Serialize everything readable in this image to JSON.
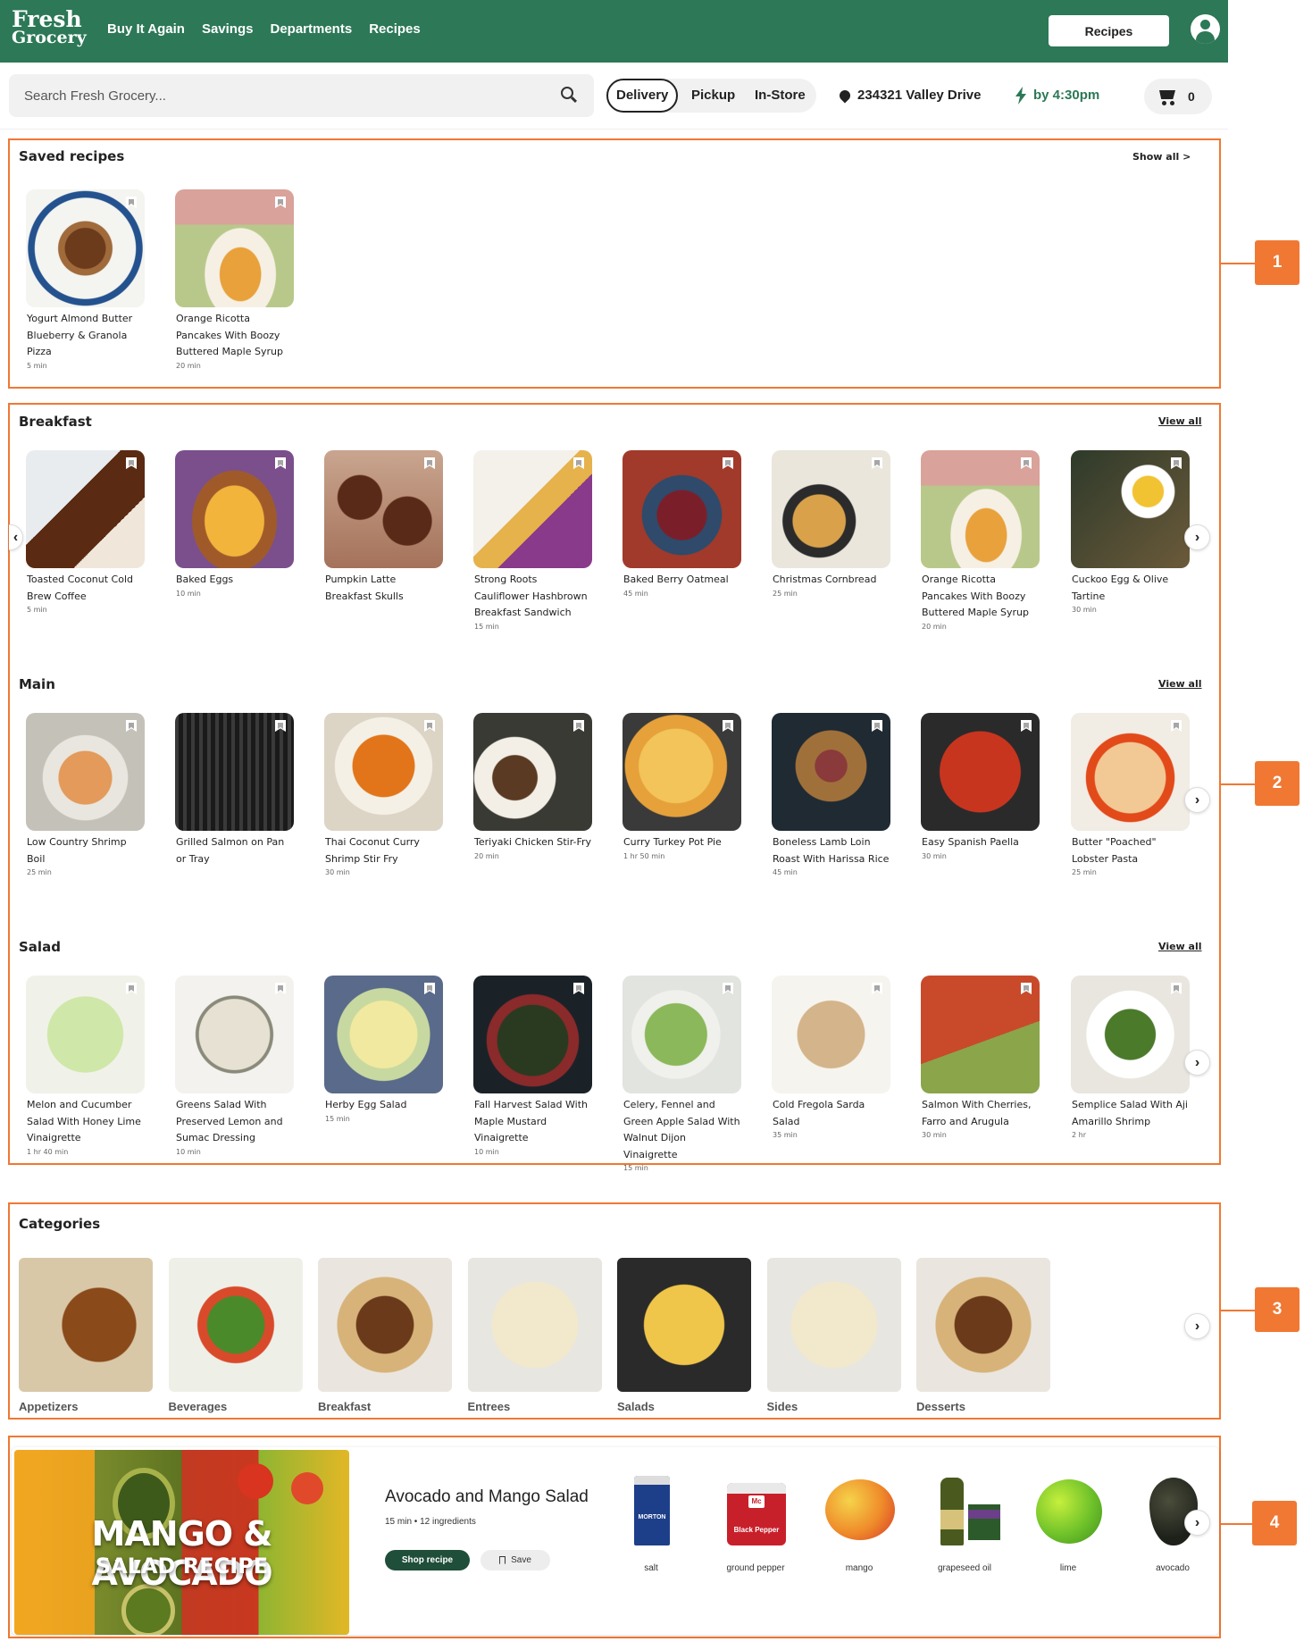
{
  "header": {
    "logo_line1": "Fresh",
    "logo_line2": "Grocery",
    "nav": [
      "Buy It Again",
      "Savings",
      "Departments",
      "Recipes"
    ],
    "recipes_button": "Recipes"
  },
  "search": {
    "placeholder": "Search Fresh Grocery...",
    "modes": [
      "Delivery",
      "Pickup",
      "In-Store"
    ],
    "active_mode": "Delivery",
    "address": "234321 Valley Drive",
    "eta": "by 4:30pm",
    "cart_count": "0"
  },
  "saved": {
    "title": "Saved recipes",
    "show_all": "Show all >",
    "items": [
      {
        "title": "Yogurt Almond Butter Blueberry & Granola Pizza",
        "time": "5 min"
      },
      {
        "title": "Orange Ricotta Pancakes With Boozy Buttered Maple Syrup",
        "time": "20 min"
      }
    ]
  },
  "rows": [
    {
      "title": "Breakfast",
      "view_all": "View all",
      "items": [
        {
          "title": "Toasted Coconut Cold Brew Coffee",
          "time": "5 min"
        },
        {
          "title": "Baked Eggs",
          "time": "10 min"
        },
        {
          "title": "Pumpkin Latte Breakfast Skulls",
          "time": ""
        },
        {
          "title": "Strong Roots Cauliflower Hashbrown Breakfast Sandwich",
          "time": "15 min"
        },
        {
          "title": "Baked Berry Oatmeal",
          "time": "45 min"
        },
        {
          "title": "Christmas Cornbread",
          "time": "25 min"
        },
        {
          "title": "Orange Ricotta Pancakes With Boozy Buttered Maple Syrup",
          "time": "20 min"
        },
        {
          "title": "Cuckoo Egg & Olive Tartine",
          "time": "30 min"
        }
      ]
    },
    {
      "title": "Main",
      "view_all": "View all",
      "items": [
        {
          "title": "Low Country Shrimp Boil",
          "time": "25 min"
        },
        {
          "title": "Grilled Salmon on Pan or Tray",
          "time": ""
        },
        {
          "title": "Thai Coconut Curry Shrimp Stir Fry",
          "time": "30 min"
        },
        {
          "title": "Teriyaki Chicken Stir-Fry",
          "time": "20 min"
        },
        {
          "title": "Curry Turkey Pot Pie",
          "time": "1 hr 50 min"
        },
        {
          "title": "Boneless Lamb Loin Roast With Harissa Rice",
          "time": "45 min"
        },
        {
          "title": "Easy Spanish Paella",
          "time": "30 min"
        },
        {
          "title": "Butter \"Poached\" Lobster Pasta",
          "time": "25 min"
        }
      ]
    },
    {
      "title": "Salad",
      "view_all": "View all",
      "items": [
        {
          "title": "Melon and Cucumber Salad With Honey Lime Vinaigrette",
          "time": "1 hr 40 min"
        },
        {
          "title": "Greens Salad With Preserved Lemon and Sumac Dressing",
          "time": "10 min"
        },
        {
          "title": "Herby Egg Salad",
          "time": "15 min"
        },
        {
          "title": "Fall Harvest Salad With Maple Mustard Vinaigrette",
          "time": "10 min"
        },
        {
          "title": "Celery, Fennel and Green Apple Salad With Walnut Dijon Vinaigrette",
          "time": "15 min"
        },
        {
          "title": "Cold Fregola Sarda Salad",
          "time": "35 min"
        },
        {
          "title": "Salmon With Cherries, Farro and Arugula",
          "time": "30 min"
        },
        {
          "title": "Semplice Salad With Aji Amarillo Shrimp",
          "time": "2 hr"
        }
      ]
    }
  ],
  "categories": {
    "title": "Categories",
    "items": [
      "Appetizers",
      "Beverages",
      "Breakfast",
      "Entrees",
      "Salads",
      "Sides",
      "Desserts"
    ]
  },
  "featured": {
    "image_headline": "MANGO & AVOCADO",
    "image_subline": "SALAD RECIPE",
    "title": "Avocado and Mango Salad",
    "meta": "15 min • 12 ingredients",
    "shop_button": "Shop recipe",
    "save_button": "Save",
    "ingredients": [
      "salt",
      "ground pepper",
      "mango",
      "grapeseed oil",
      "lime",
      "avocado"
    ],
    "product_text": {
      "salt": "MORTON",
      "pepper": "Black Pepper",
      "brand": "Mc"
    }
  },
  "annotations": [
    "1",
    "2",
    "3",
    "4"
  ],
  "colors": {
    "brand_green": "#2c7857",
    "annotation_orange": "#f07833",
    "shop_button": "#1f4e3a"
  }
}
